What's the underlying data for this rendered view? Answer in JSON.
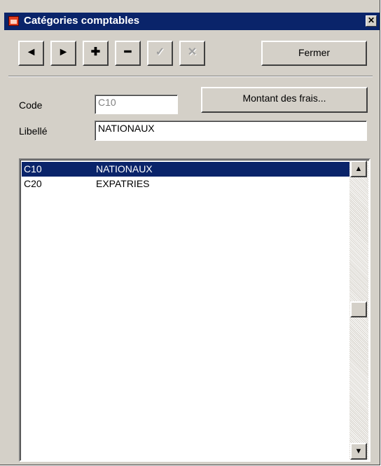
{
  "window": {
    "title": "Catégories comptables",
    "close_glyph": "✕"
  },
  "toolbar": {
    "prev_glyph": "◄",
    "next_glyph": "►",
    "add_glyph": "✚",
    "delete_glyph": "━",
    "validate_glyph": "✓",
    "cancel_glyph": "✕",
    "fermer_label": "Fermer"
  },
  "form": {
    "code_label": "Code",
    "code_value": "C10",
    "libelle_label": "Libellé",
    "libelle_value": "NATIONAUX",
    "montant_button_label": "Montant des frais..."
  },
  "list": {
    "rows": [
      {
        "code": "C10",
        "libelle": "NATIONAUX",
        "selected": true
      },
      {
        "code": "C20",
        "libelle": "EXPATRIES",
        "selected": false
      }
    ],
    "scroll_up_glyph": "▲",
    "scroll_down_glyph": "▼"
  },
  "colors": {
    "title_bar": "#0a246a",
    "selection": "#0a246a",
    "face": "#d4d0c8"
  }
}
